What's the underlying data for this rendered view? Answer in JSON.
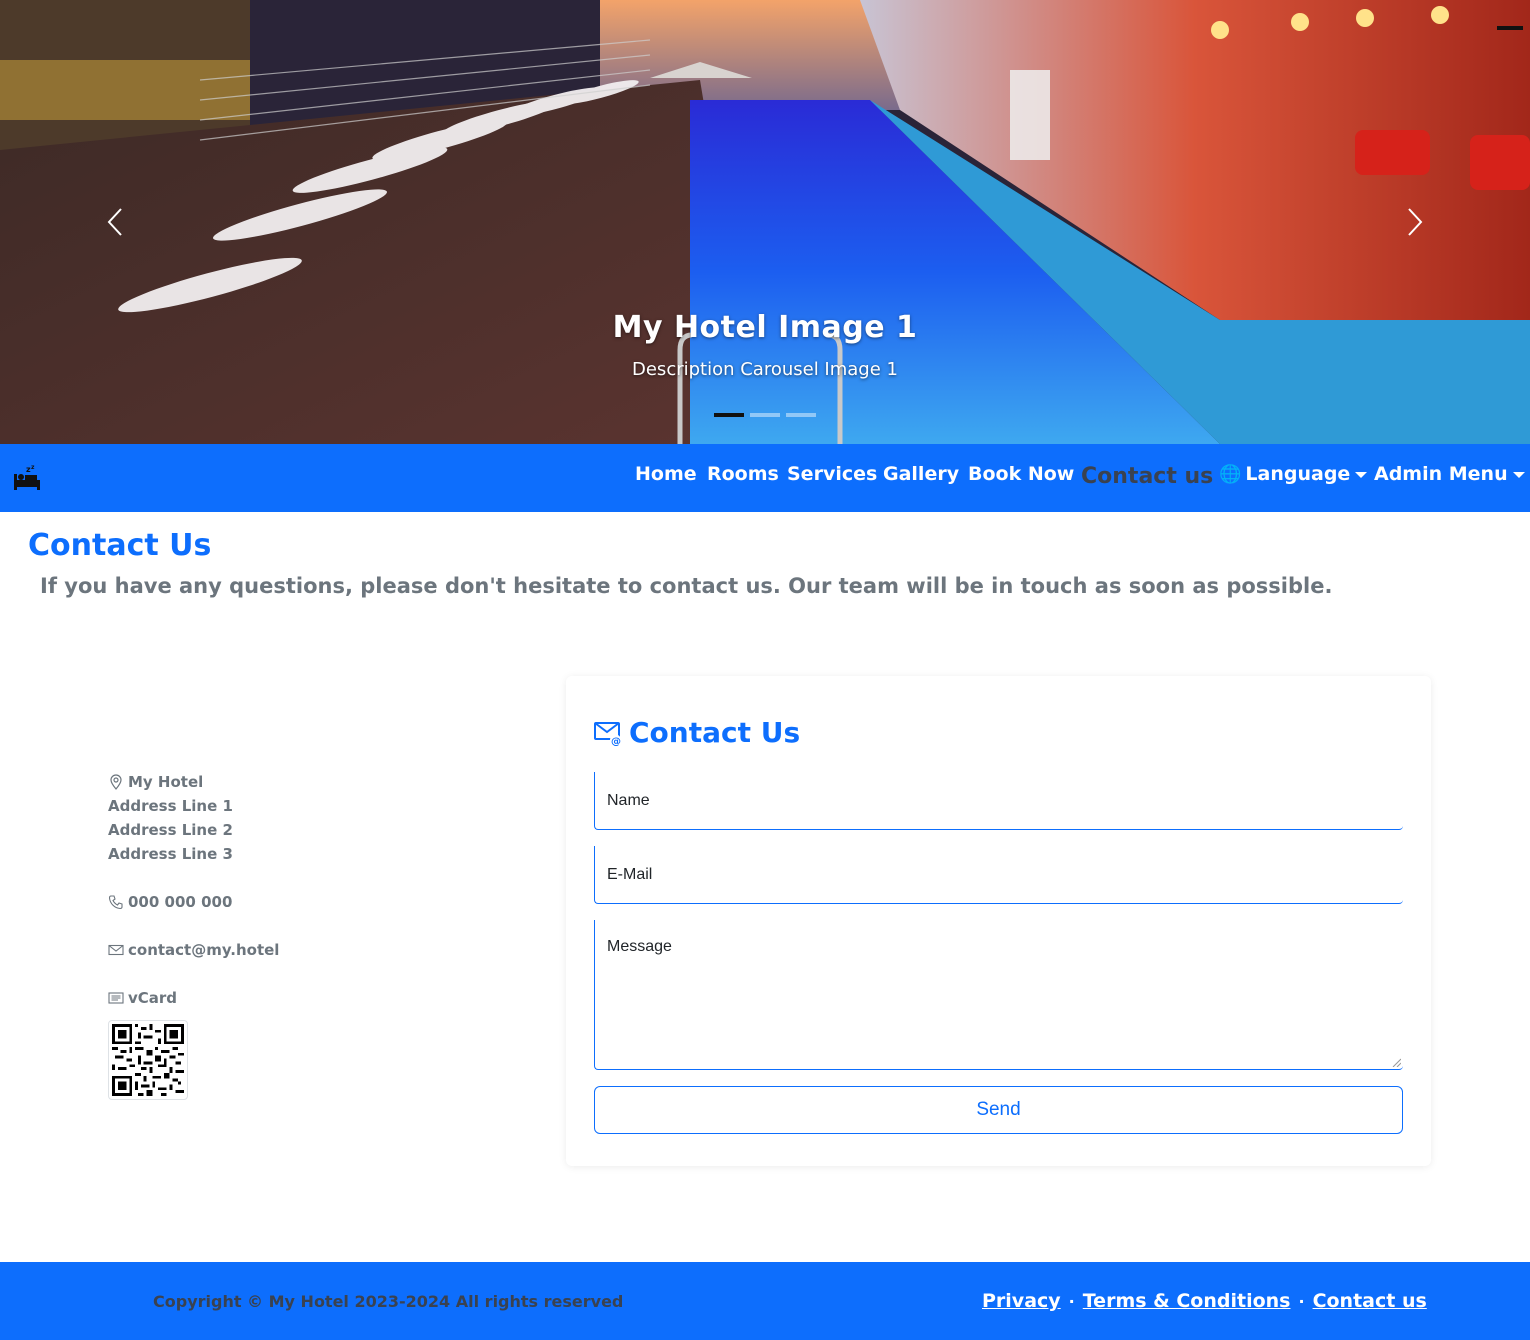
{
  "carousel": {
    "title": "My Hotel Image 1",
    "description": "Description Carousel Image 1",
    "slide_count": 3,
    "active_slide": 1
  },
  "navbar": {
    "brand_icon": "hotel-bed-icon",
    "items": {
      "home": "Home",
      "rooms": "Rooms",
      "services": "Services",
      "gallery": "Gallery",
      "book_now": "Book Now",
      "contact_us": "Contact us",
      "language": "Language",
      "admin_menu": "Admin Menu"
    },
    "active": "contact_us"
  },
  "page": {
    "title": "Contact Us",
    "intro": "If you have any questions, please don't hesitate to contact us. Our team will be in touch as soon as possible."
  },
  "contact_info": {
    "name": "My Hotel",
    "address_line_1": "Address Line 1",
    "address_line_2": "Address Line 2",
    "address_line_3": "Address Line 3",
    "phone": "000 000 000",
    "email": "contact@my.hotel",
    "vcard": "vCard"
  },
  "form": {
    "title": "Contact Us",
    "name_placeholder": "Name",
    "email_placeholder": "E-Mail",
    "message_placeholder": "Message",
    "send_label": "Send"
  },
  "footer": {
    "copyright": "Copyright © My Hotel 2023-2024 All rights reserved",
    "links": {
      "privacy": "Privacy",
      "terms": "Terms & Conditions",
      "contact": "Contact us"
    },
    "separator": "·"
  },
  "colors": {
    "primary": "#0d6efd",
    "muted_text": "#6c757d",
    "dark_text": "#3a4250"
  }
}
